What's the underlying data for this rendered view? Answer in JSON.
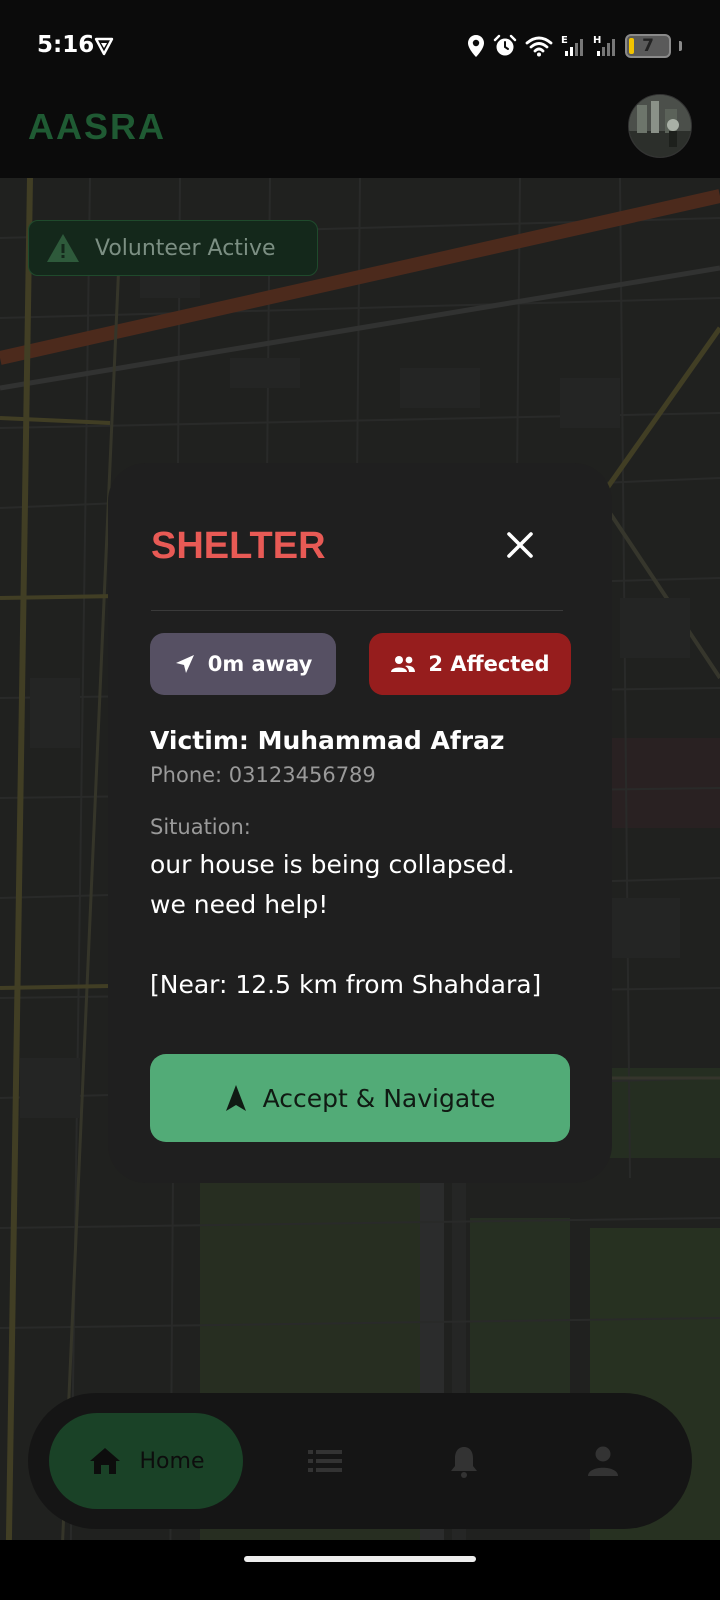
{
  "status_bar": {
    "time": "5:16",
    "battery_level": "7",
    "icons": [
      "vpn-icon",
      "location-icon",
      "alarm-icon",
      "wifi-icon",
      "signal-e-icon",
      "signal-h-icon",
      "battery-icon"
    ]
  },
  "app_bar": {
    "title": "AASRA",
    "avatar_icon": "avatar"
  },
  "map": {
    "status_chip_label": "Volunteer Active",
    "status_chip_icon": "warning-icon"
  },
  "alert_dialog": {
    "title": "SHELTER",
    "close_icon": "close-icon",
    "distance_label": "0m away",
    "distance_icon": "navigation-arrow-icon",
    "affected_label": "2 Affected",
    "affected_icon": "people-icon",
    "victim_name": "Victim: Muhammad Afraz",
    "victim_phone": "Phone: 03123456789",
    "situation_label": "Situation:",
    "situation_text": "our house is being collapsed.\nwe need help!\n\n[Near: 12.5 km from Shahdara]",
    "accept_label": "Accept & Navigate",
    "accept_icon": "navigation-icon"
  },
  "bottom_nav": {
    "home_label": "Home",
    "items": [
      "home-icon",
      "list-icon",
      "bell-icon",
      "person-icon"
    ]
  },
  "colors": {
    "brand": "#1f5a33",
    "title_red": "#e85a55",
    "accept_green": "#52ab77",
    "affected_red": "#961d1d",
    "distance_chip": "#565063"
  }
}
